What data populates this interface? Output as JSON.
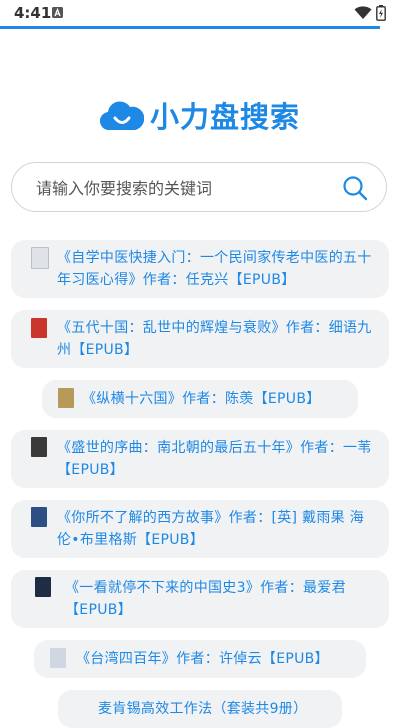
{
  "status_bar": {
    "time": "4:41",
    "notification_icon": "a-letter-icon",
    "wifi_icon": "wifi-icon",
    "battery_icon": "battery-charging-icon"
  },
  "app": {
    "logo_icon": "cloud-smile-icon",
    "title": "小力盘搜索",
    "accent_color": "#1e88e5"
  },
  "search": {
    "placeholder": "请输入你要搜索的关键词",
    "value": "",
    "button_icon": "search-icon"
  },
  "results": [
    {
      "title": "《自学中医快捷入门：一个民间家传老中医的五十年习医心得》作者：任克兴【EPUB】"
    },
    {
      "title": "《五代十国：乱世中的辉煌与衰败》作者：细语九州【EPUB】"
    },
    {
      "title": "《纵横十六国》作者：陈羡【EPUB】"
    },
    {
      "title": "《盛世的序曲：南北朝的最后五十年》作者：一苇【EPUB】"
    },
    {
      "title": "《你所不了解的西方故事》作者：[英] 戴雨果 海伦•布里格斯【EPUB】"
    },
    {
      "title": "《一看就停不下来的中国史3》作者：最爱君【EPUB】"
    },
    {
      "title": "《台湾四百年》作者：许倬云【EPUB】"
    },
    {
      "title": "麦肯锡高效工作法（套装共9册）"
    }
  ]
}
